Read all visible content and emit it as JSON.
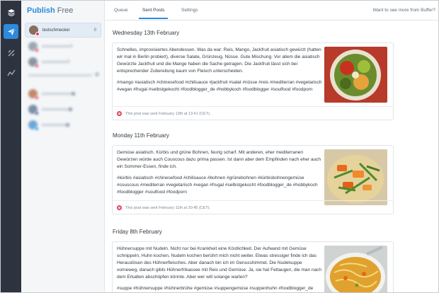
{
  "app": {
    "brand_name": "Publish",
    "brand_plan": "Free"
  },
  "rail": {
    "icons": [
      "layers-icon",
      "paper-plane-icon",
      "analyze-icon",
      "chart-line-icon"
    ]
  },
  "tabs": [
    {
      "label": "Queue"
    },
    {
      "label": "Sent Posts"
    },
    {
      "label": "Settings"
    }
  ],
  "upgrade_text": "Want to see more from Buffer?",
  "profiles": {
    "active": {
      "name": "testschmecker",
      "count": "0"
    }
  },
  "posts": [
    {
      "day": "Wednesday 13th February",
      "paragraphs": [
        "Schnelles, improvisiertes Abendessen. Was da war: Reis, Mango, Jackfruit asiatisch gewürzt (hatten wir mal in Berlin probiert), diverse Salate, Grünzeug, Nüsse. Gute Mischung. Vor allem die asiatisch Gewürzte Jackfruit und die Mange haben die Sache getragen. Die Jackfruit lässt sich bei entsprechender Zubereitung kaum von Fleisch unterscheiden.",
        "#mango #asiatisch #chinesefood #chilisauce #jackfruit #salat #nüsse #reis #mediterran #vegetarisch #vegan #frugal #selbstgekocht #foodblogger_de #hobbykoch #foodblogger #soulfood #foodporn"
      ],
      "sent_text": "This post was sent February 13th at 13:41 (CET)."
    },
    {
      "day": "Monday 11th February",
      "paragraphs": [
        "Gemüse asiatisch. Kürbis und grüne Bohnen, feurig scharf. Mit  anderen, eher mediterranen Gewürzen würde auch Couscous dazu prima passen. Ist dann aber dem Empfinden nach eher auch ein Sommer-Essen, finde ich.",
        "#kürbis #asiatisch #chinesefood #chilisauce #bohnen #grünebohnen #kürbisbohnengemüse #couscous #mediterran #vegetarisch #vegan #frugal #selbstgekocht #foodblogger_de #hobbykoch #foodblogger #soulfood #foodporn"
      ],
      "sent_text": "This post was sent February 11th at 20:45 (CET)."
    },
    {
      "day": "Friday 8th February",
      "paragraphs": [
        "Hühnersuppe mit Nudeln. Nicht nur bei Krankheit eine Köstlichkeit. Der Aufwand mit Gemüse schnippeln, Huhn kochen, Nudeln kochen berührt mich nicht weiter. Etwas stressiger finde ich das Herauslösen des Hühnerfleisches. Aber danach bin ich im Genusshimmel. Die Nudelsuppe vorneweg, danach gibts Hühnerfrikassee mit Reis und Gemüse. Ja, sie hat Fettaugen, die man nach dem Erkalten abschöpfen könnte. Aber wer will solange warten?",
        "#suppe #hühnersuppe #hühnerbrühe #gemüse #suppengemüse #suppenhuhn #foodblogger_de"
      ],
      "sent_text": ""
    }
  ],
  "colors": {
    "accent": "#2c8bdc",
    "rail": "#2e3340",
    "instagram": "#e4405f"
  }
}
